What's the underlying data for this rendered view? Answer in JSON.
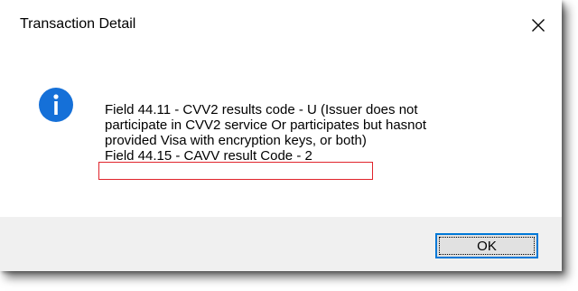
{
  "dialog": {
    "title": "Transaction Detail",
    "close_icon": "close-icon",
    "info_icon": "info-icon",
    "accent_color": "#0078d7",
    "highlight_color": "#e0242c",
    "message_lines": [
      " Field 44.11 - CVV2 results code - U  (Issuer does not",
      "participate in CVV2 service Or participates but hasnot",
      "provided Visa with encryption keys, or both)",
      "Field 44.15 - CAVV result Code - 2"
    ],
    "ok_label": "OK"
  }
}
